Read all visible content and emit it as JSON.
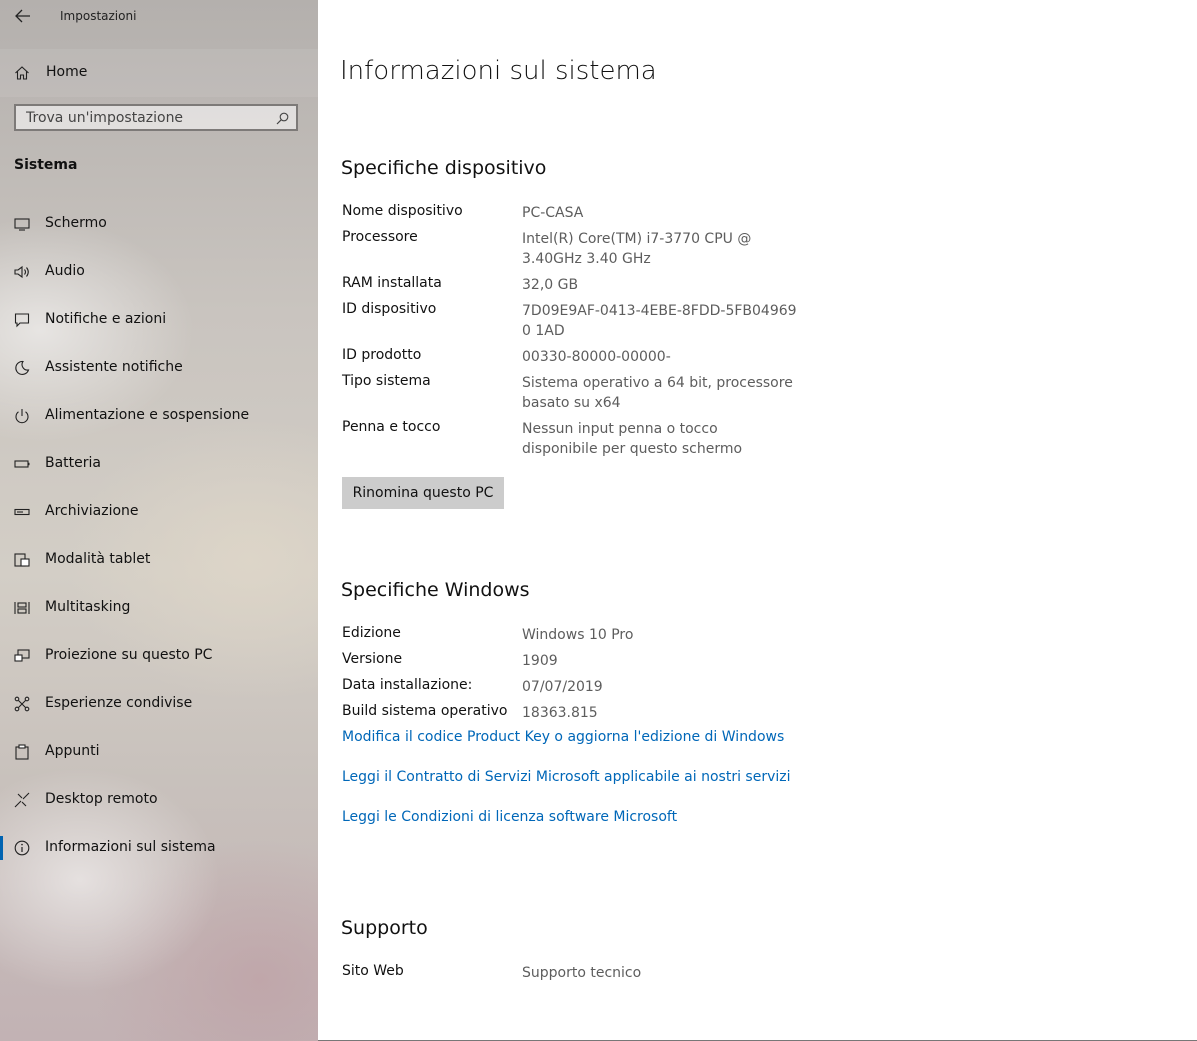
{
  "window": {
    "title": "Impostazioni"
  },
  "sidebar": {
    "home_label": "Home",
    "search_placeholder": "Trova un'impostazione",
    "section": "Sistema",
    "items": [
      {
        "label": "Schermo",
        "icon": "monitor-icon"
      },
      {
        "label": "Audio",
        "icon": "speaker-icon"
      },
      {
        "label": "Notifiche e azioni",
        "icon": "notification-icon"
      },
      {
        "label": "Assistente notifiche",
        "icon": "moon-icon"
      },
      {
        "label": "Alimentazione e sospensione",
        "icon": "power-icon"
      },
      {
        "label": "Batteria",
        "icon": "battery-icon"
      },
      {
        "label": "Archiviazione",
        "icon": "storage-icon"
      },
      {
        "label": "Modalità tablet",
        "icon": "tablet-mode-icon"
      },
      {
        "label": "Multitasking",
        "icon": "multitasking-icon"
      },
      {
        "label": "Proiezione su questo PC",
        "icon": "projection-icon"
      },
      {
        "label": "Esperienze condivise",
        "icon": "shared-experiences-icon"
      },
      {
        "label": "Appunti",
        "icon": "clipboard-icon"
      },
      {
        "label": "Desktop remoto",
        "icon": "remote-desktop-icon"
      },
      {
        "label": "Informazioni sul sistema",
        "icon": "info-icon",
        "active": true
      }
    ]
  },
  "main": {
    "title": "Informazioni sul sistema",
    "device_specs": {
      "heading": "Specifiche dispositivo",
      "rows": [
        {
          "key": "Nome dispositivo",
          "value": "PC-CASA"
        },
        {
          "key": "Processore",
          "value": "Intel(R) Core(TM) i7-3770 CPU @ 3.40GHz   3.40 GHz"
        },
        {
          "key": "RAM installata",
          "value": "32,0 GB"
        },
        {
          "key": "ID dispositivo",
          "value": "7D09E9AF-0413-4EBE-8FDD-5FB049690 1AD"
        },
        {
          "key": "ID prodotto",
          "value": "00330-80000-00000-"
        },
        {
          "key": "Tipo sistema",
          "value": "Sistema operativo a 64 bit, processore basato su x64"
        },
        {
          "key": "Penna e tocco",
          "value": "Nessun input penna o tocco disponibile per questo schermo"
        }
      ],
      "rename_button": "Rinomina questo PC"
    },
    "windows_specs": {
      "heading": "Specifiche Windows",
      "rows": [
        {
          "key": "Edizione",
          "value": "Windows 10 Pro"
        },
        {
          "key": "Versione",
          "value": "1909"
        },
        {
          "key": "Data installazione:",
          "value": "07/07/2019"
        },
        {
          "key": "Build sistema operativo",
          "value": "18363.815"
        }
      ],
      "links": [
        "Modifica il codice Product Key o aggiorna l'edizione di Windows",
        "Leggi il Contratto di Servizi Microsoft applicabile ai nostri servizi",
        "Leggi le Condizioni di licenza software Microsoft"
      ]
    },
    "support": {
      "heading": "Supporto",
      "key": "Sito Web",
      "link": "Supporto tecnico"
    }
  }
}
